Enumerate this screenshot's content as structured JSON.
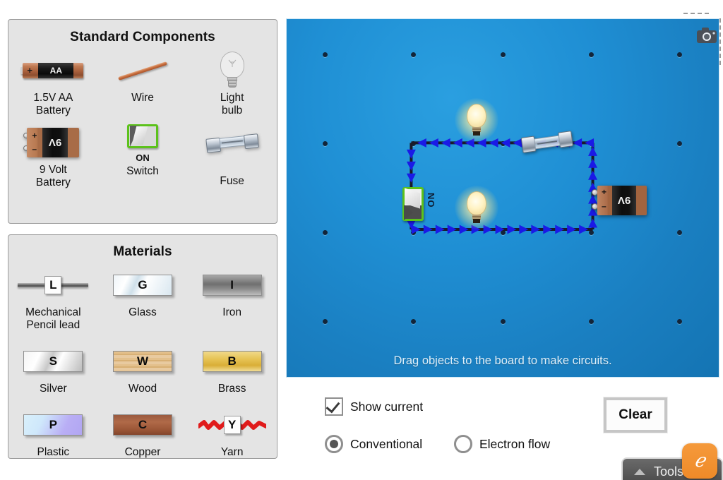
{
  "panels": {
    "standard": {
      "title": "Standard Components",
      "items": [
        {
          "label": "1.5V AA\nBattery",
          "icon": "aa-battery-icon",
          "aa_label": "AA",
          "plus": "+"
        },
        {
          "label": "Wire",
          "icon": "wire-icon"
        },
        {
          "label": "Light\nbulb",
          "icon": "light-bulb-icon"
        },
        {
          "label": "9 Volt\nBattery",
          "icon": "nine-volt-battery-icon",
          "v9_label": "9V",
          "plus": "+",
          "minus": "–"
        },
        {
          "label": "Switch",
          "icon": "switch-icon",
          "state_label": "ON"
        },
        {
          "label": "Fuse",
          "icon": "fuse-icon"
        }
      ]
    },
    "materials": {
      "title": "Materials",
      "items": [
        {
          "label": "Mechanical\nPencil lead",
          "letter": "L",
          "icon": "pencil-lead-icon"
        },
        {
          "label": "Glass",
          "letter": "G",
          "icon": "glass-tile-icon"
        },
        {
          "label": "Iron",
          "letter": "I",
          "icon": "iron-tile-icon"
        },
        {
          "label": "Silver",
          "letter": "S",
          "icon": "silver-tile-icon"
        },
        {
          "label": "Wood",
          "letter": "W",
          "icon": "wood-tile-icon"
        },
        {
          "label": "Brass",
          "letter": "B",
          "icon": "brass-tile-icon"
        },
        {
          "label": "Plastic",
          "letter": "P",
          "icon": "plastic-tile-icon"
        },
        {
          "label": "Copper",
          "letter": "C",
          "icon": "copper-tile-icon"
        },
        {
          "label": "Yarn",
          "letter": "Y",
          "icon": "yarn-icon"
        }
      ]
    }
  },
  "board": {
    "hint": "Drag objects to the board to make circuits.",
    "camera_icon": "camera-snapshot-icon",
    "grid": {
      "cols": 5,
      "rows": 4
    },
    "circuit": {
      "switch_state_label": "ON",
      "battery_label": "9V",
      "battery_plus": "+",
      "battery_minus": "–",
      "components": [
        "light-bulb-lit",
        "fuse",
        "nine-volt-battery",
        "switch-on",
        "light-bulb-lit"
      ],
      "current_direction": "conventional"
    }
  },
  "controls": {
    "show_current": {
      "label": "Show current",
      "checked": true
    },
    "flow_mode": {
      "selected": "Conventional",
      "options": [
        "Conventional",
        "Electron flow"
      ]
    },
    "clear_label": "Clear"
  },
  "tools": {
    "label": "Tools",
    "collapse_icon": "triangle-up-icon",
    "logo": "gizmos-logo",
    "logo_glyph": "ℯ"
  },
  "colors": {
    "board_blue": "#1f8fd4",
    "current_arrow": "#1a1ae6",
    "panel_bg": "#e4e4e4",
    "switch_green": "#5cc21b",
    "accent_orange": "#ef8a28"
  }
}
